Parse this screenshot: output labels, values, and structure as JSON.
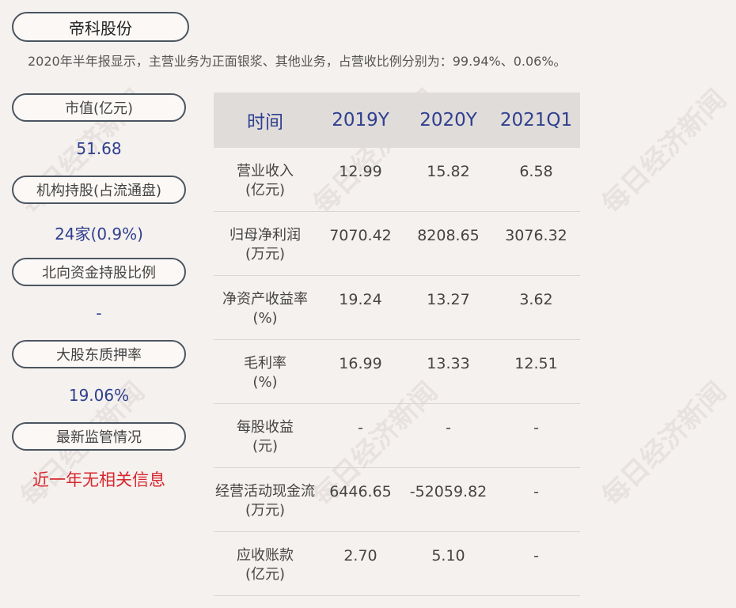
{
  "title": "帝科股份",
  "subtitle": "2020年半年报显示，主营业务为正面银浆、其他业务，占营收比例分别为：99.94%、0.06%。",
  "side": [
    {
      "label": "市值(亿元)",
      "value": "51.68"
    },
    {
      "label": "机构持股(占流通盘)",
      "value": "24家(0.9%)"
    },
    {
      "label": "北向资金持股比例",
      "value": "-"
    },
    {
      "label": "大股东质押率",
      "value": "19.06%"
    },
    {
      "label": "最新监管情况",
      "value": "近一年无相关信息"
    }
  ],
  "table": {
    "headers": [
      "时间",
      "2019Y",
      "2020Y",
      "2021Q1"
    ],
    "rows": [
      {
        "label1": "营业收入",
        "label2": "(亿元)",
        "values": [
          "12.99",
          "15.82",
          "6.58"
        ]
      },
      {
        "label1": "归母净利润",
        "label2": "(万元)",
        "values": [
          "7070.42",
          "8208.65",
          "3076.32"
        ]
      },
      {
        "label1": "净资产收益率",
        "label2": "(%)",
        "values": [
          "19.24",
          "13.27",
          "3.62"
        ]
      },
      {
        "label1": "毛利率",
        "label2": "(%)",
        "values": [
          "16.99",
          "13.33",
          "12.51"
        ]
      },
      {
        "label1": "每股收益",
        "label2": "(元)",
        "values": [
          "-",
          "-",
          "-"
        ]
      },
      {
        "label1": "经营活动现金流",
        "label2": "(万元)",
        "values": [
          "6446.65",
          "-52059.82",
          "-"
        ]
      },
      {
        "label1": "应收账款",
        "label2": "(亿元)",
        "values": [
          "2.70",
          "5.10",
          "-"
        ]
      }
    ]
  },
  "watermark": "每日经济新闻",
  "colors": {
    "accent": "#2f3f8f",
    "alert": "#d7262d",
    "background": "#f5f1ee"
  }
}
